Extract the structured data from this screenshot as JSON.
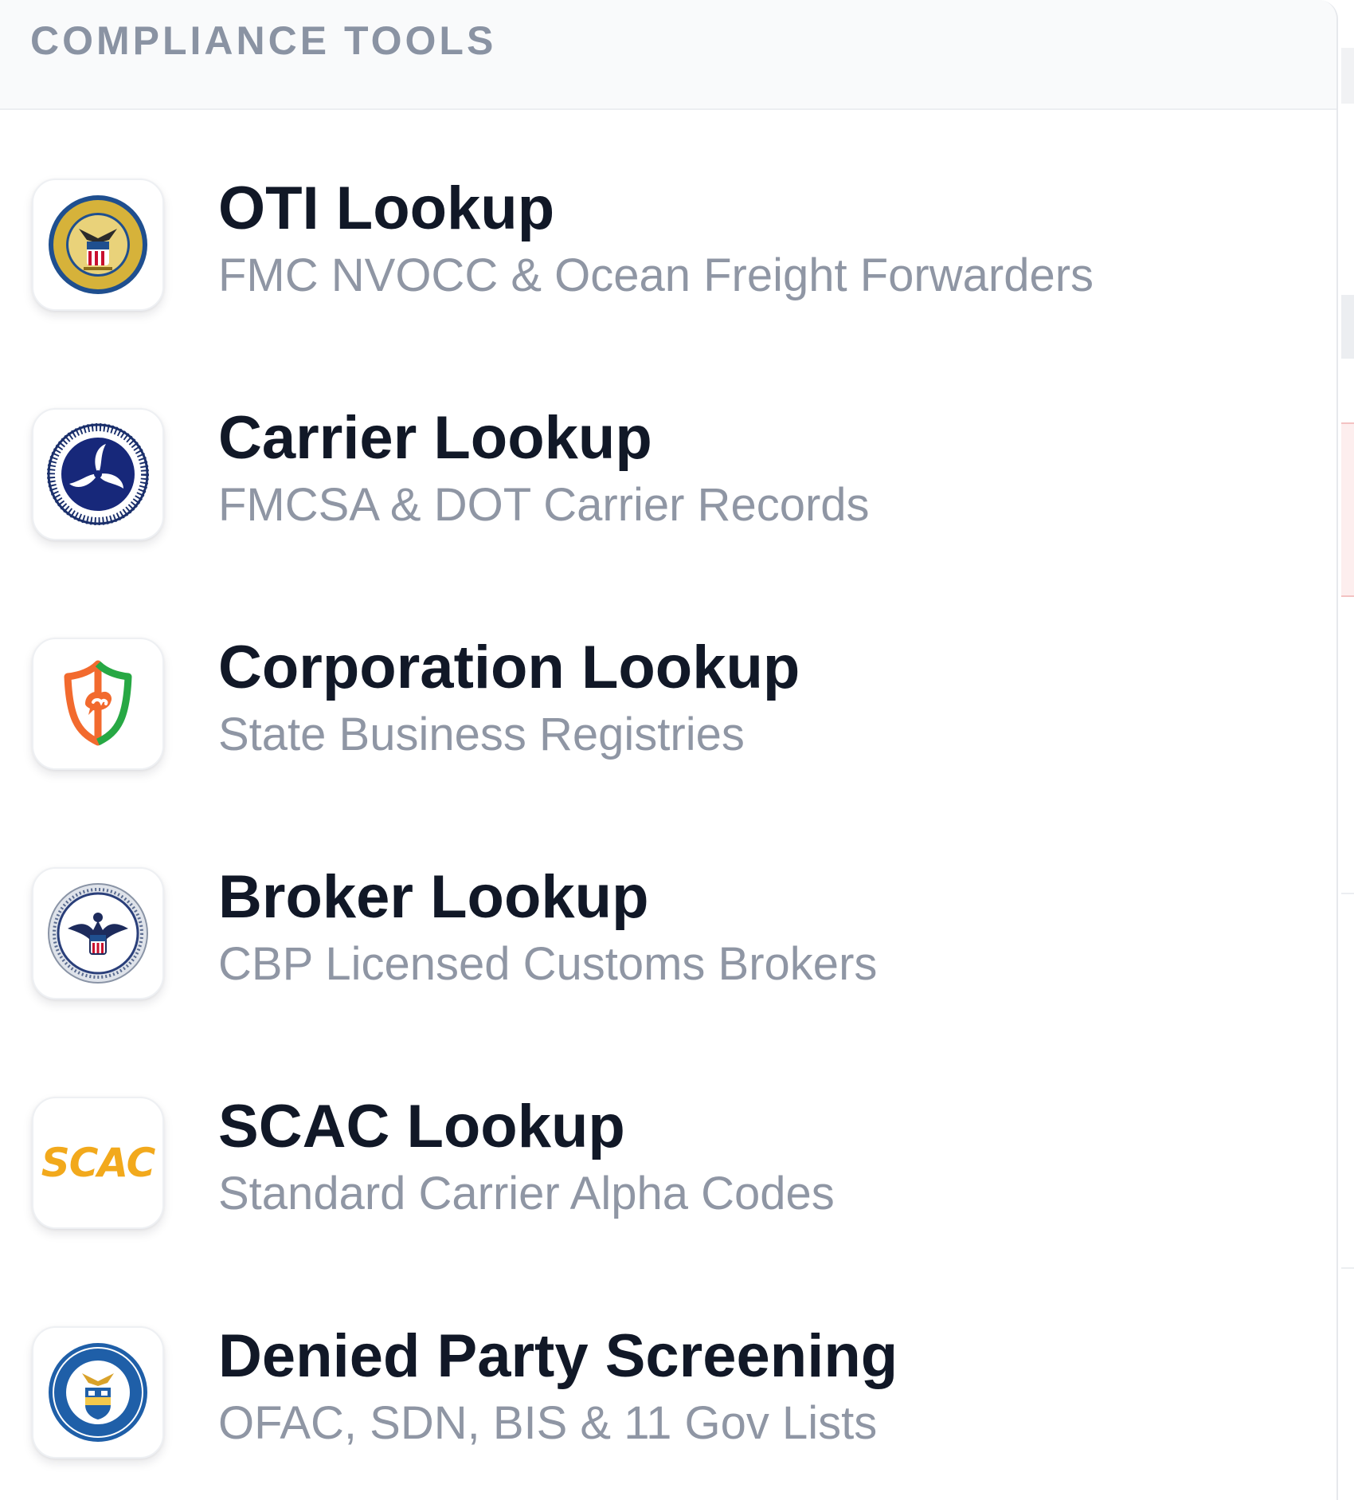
{
  "panel": {
    "title": "COMPLIANCE TOOLS"
  },
  "tools": [
    {
      "name": "OTI Lookup",
      "description": "FMC NVOCC & Ocean Freight Forwarders",
      "icon": "fmc-seal-icon"
    },
    {
      "name": "Carrier Lookup",
      "description": "FMCSA & DOT Carrier Records",
      "icon": "dot-seal-icon"
    },
    {
      "name": "Corporation Lookup",
      "description": "State Business Registries",
      "icon": "shield-icon"
    },
    {
      "name": "Broker Lookup",
      "description": "CBP Licensed Customs Brokers",
      "icon": "cbp-seal-icon"
    },
    {
      "name": "SCAC Lookup",
      "description": "Standard Carrier Alpha Codes",
      "icon": "scac-logo-icon",
      "logo_text": "SCAC"
    },
    {
      "name": "Denied Party Screening",
      "description": "OFAC, SDN, BIS & 11 Gov Lists",
      "icon": "commerce-seal-icon"
    }
  ],
  "colors": {
    "title": "#111827",
    "subtitle": "#8f96a4",
    "section_label": "#8a93a3",
    "scac_accent": "#f2a91c",
    "shield_orange": "#f26a2e",
    "shield_green": "#27a844"
  }
}
